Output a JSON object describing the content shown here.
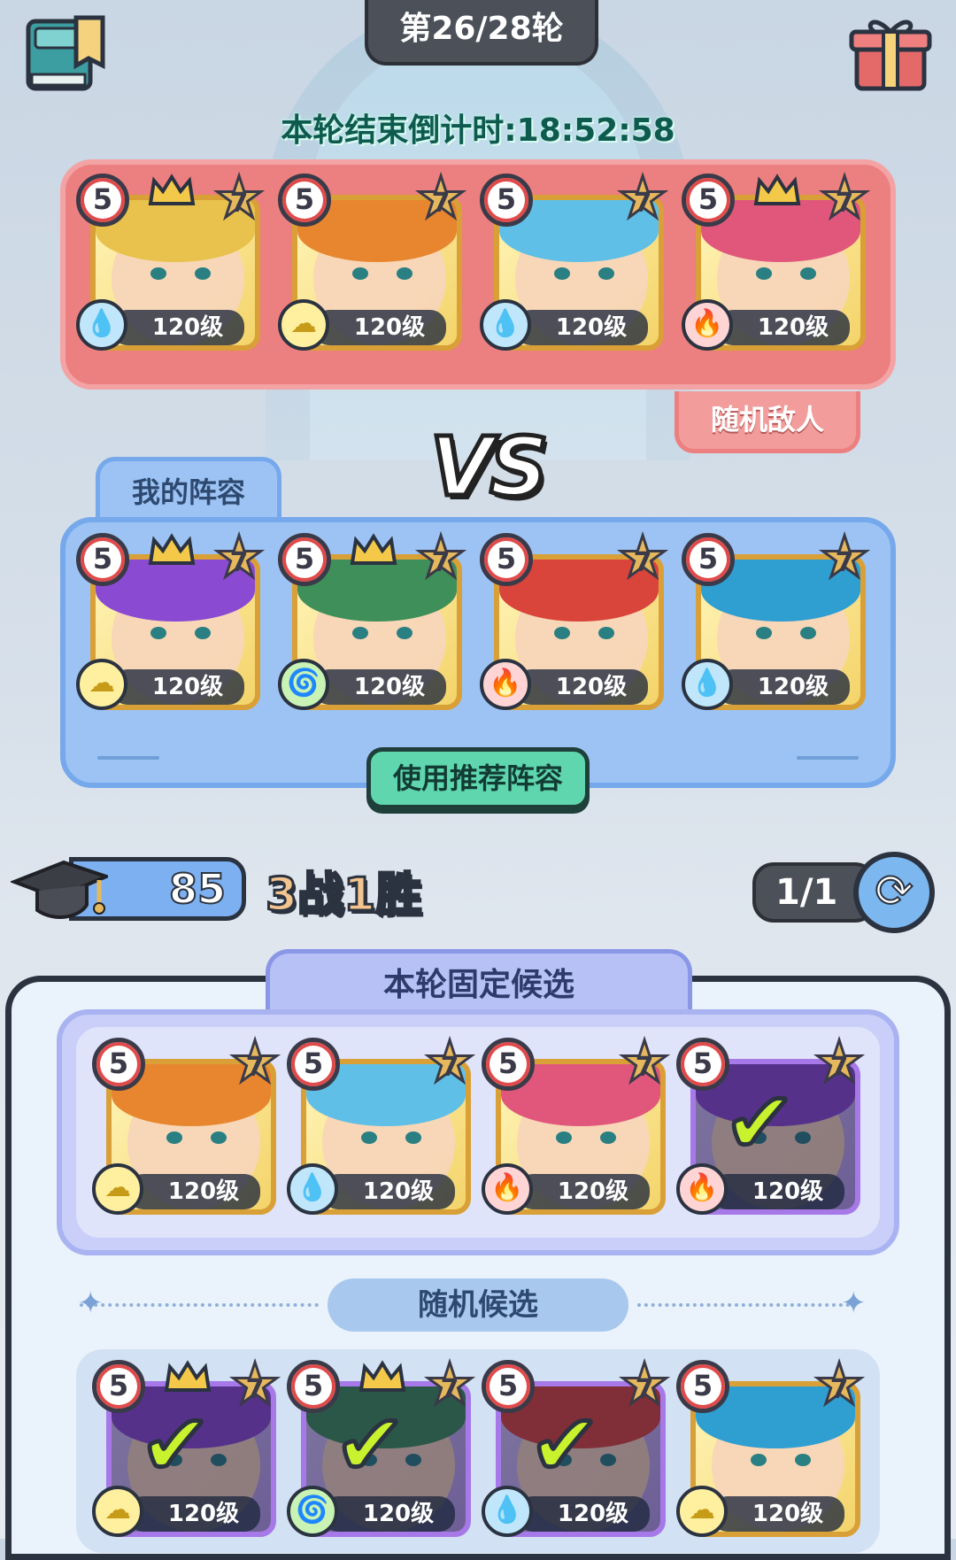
{
  "header": {
    "round": "第26/28轮",
    "countdown": "本轮结束倒计时:18:52:58",
    "book_icon": "book-icon",
    "gift_icon": "gift-icon"
  },
  "enemy": {
    "tag": "随机敌人",
    "heroes": [
      {
        "stars": "5",
        "rank": "7",
        "level": "120级",
        "element": "water",
        "crown": true
      },
      {
        "stars": "5",
        "rank": "7",
        "level": "120级",
        "element": "earth",
        "crown": false
      },
      {
        "stars": "5",
        "rank": "7",
        "level": "120级",
        "element": "water",
        "crown": false
      },
      {
        "stars": "5",
        "rank": "7",
        "level": "120级",
        "element": "fire",
        "crown": true
      }
    ]
  },
  "vs": "VS",
  "mine": {
    "tag": "我的阵容",
    "recommend_button": "使用推荐阵容",
    "heroes": [
      {
        "stars": "5",
        "rank": "7",
        "level": "120级",
        "element": "earth",
        "crown": true
      },
      {
        "stars": "5",
        "rank": "7",
        "level": "120级",
        "element": "wind",
        "crown": true
      },
      {
        "stars": "5",
        "rank": "7",
        "level": "120级",
        "element": "fire",
        "crown": false
      },
      {
        "stars": "5",
        "rank": "7",
        "level": "120级",
        "element": "water",
        "crown": false
      }
    ]
  },
  "stats": {
    "score": "85",
    "record": "3战1胜",
    "refresh_count": "1/1",
    "hat_icon": "graduation-cap-icon",
    "refresh_icon": "refresh-icon"
  },
  "fixed": {
    "title": "本轮固定候选",
    "heroes": [
      {
        "stars": "5",
        "rank": "7",
        "level": "120级",
        "element": "earth",
        "selected": false
      },
      {
        "stars": "5",
        "rank": "7",
        "level": "120级",
        "element": "water",
        "selected": false
      },
      {
        "stars": "5",
        "rank": "7",
        "level": "120级",
        "element": "fire",
        "selected": false
      },
      {
        "stars": "5",
        "rank": "7",
        "level": "120级",
        "element": "fire",
        "selected": true
      }
    ]
  },
  "random": {
    "title": "随机候选",
    "heroes": [
      {
        "stars": "5",
        "rank": "7",
        "level": "120级",
        "element": "earth",
        "selected": true,
        "crown": true
      },
      {
        "stars": "5",
        "rank": "7",
        "level": "120级",
        "element": "wind",
        "selected": true,
        "crown": true
      },
      {
        "stars": "5",
        "rank": "7",
        "level": "120级",
        "element": "water",
        "selected": true,
        "crown": false
      },
      {
        "stars": "5",
        "rank": "7",
        "level": "120级",
        "element": "earth",
        "selected": false,
        "crown": false
      }
    ]
  },
  "colors": {
    "enemy_panel": "#ec7f7f",
    "mine_panel": "#9cc3f3",
    "accent_green": "#5fd6ad",
    "check": "#c8f22e"
  }
}
